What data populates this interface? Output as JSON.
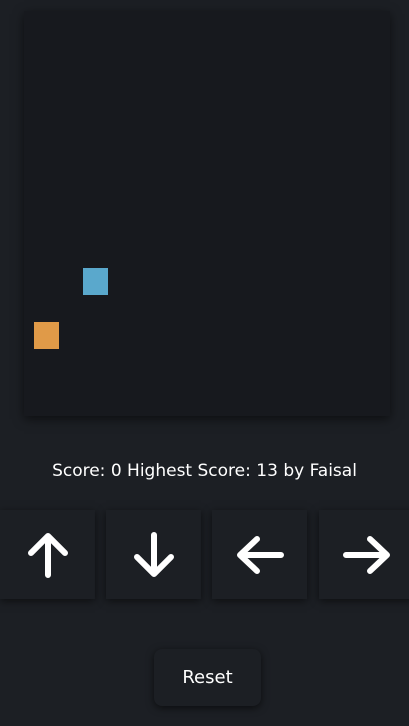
{
  "board": {
    "background": "#17191e"
  },
  "pieces": {
    "snake_color": "#5aa8cc",
    "food_color": "#e09a48"
  },
  "scores": {
    "score_label": "Score:",
    "score_value": "0",
    "highest_label": "Highest Score:",
    "highest_value": "13",
    "by_text": "by",
    "holder": "Faisal"
  },
  "controls": {
    "up_icon": "arrow-up-icon",
    "down_icon": "arrow-down-icon",
    "left_icon": "arrow-left-icon",
    "right_icon": "arrow-right-icon",
    "reset_label": "Reset"
  }
}
